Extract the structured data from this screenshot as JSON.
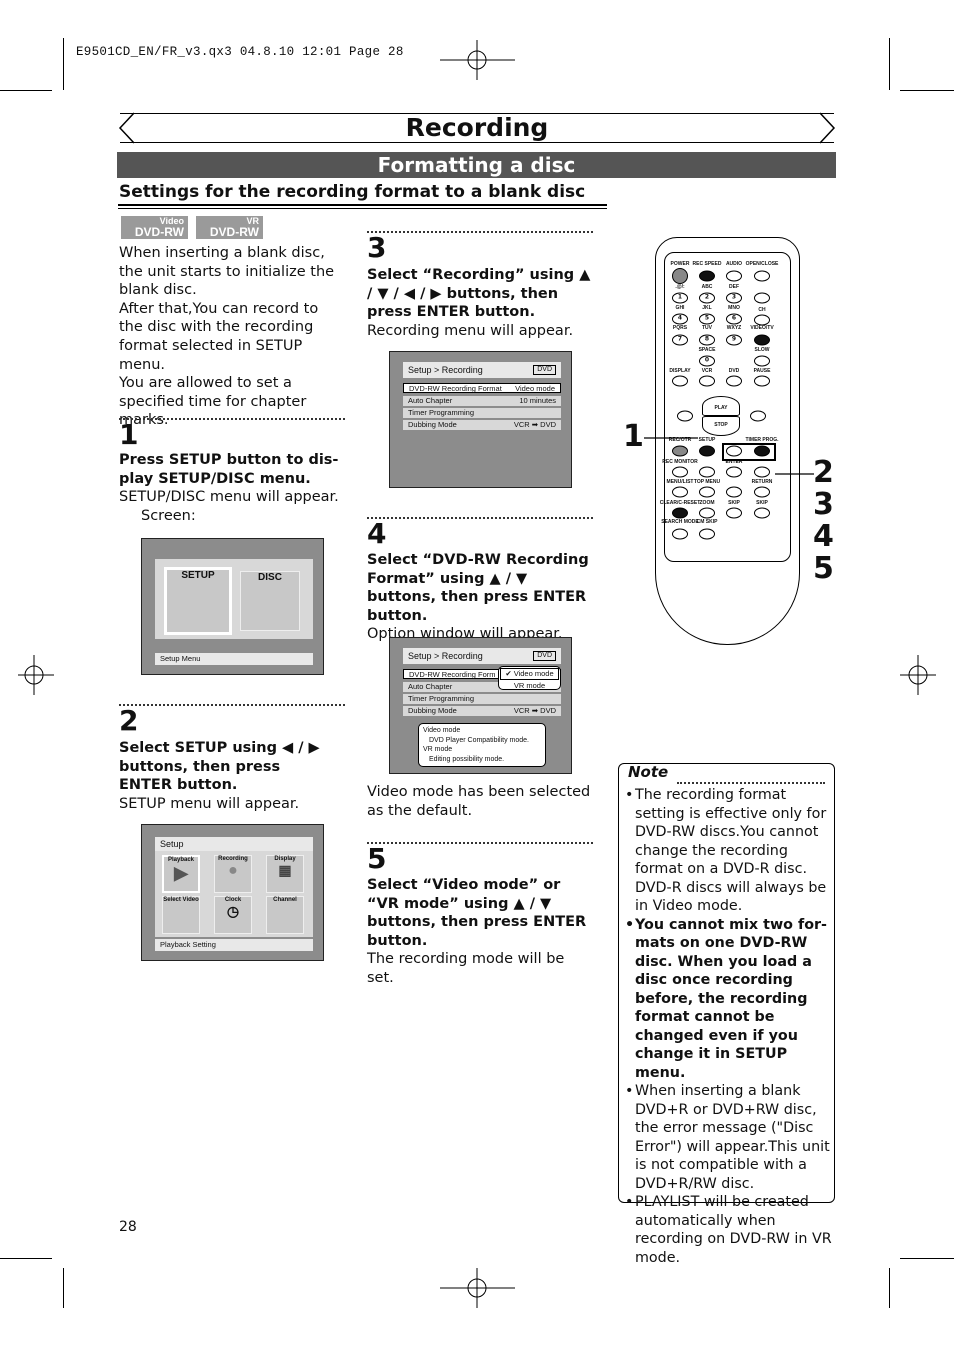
{
  "slug": "E9501CD_EN/FR_v3.qx3   04.8.10   12:01   Page 28",
  "title": "Recording",
  "subtitle": "Formatting a disc",
  "section": "Settings for the recording format to a blank disc",
  "logos": [
    {
      "top": "Video",
      "main": "DVD-RW"
    },
    {
      "top": "VR",
      "main": "DVD-RW"
    }
  ],
  "intro": [
    "When inserting a blank disc, the unit starts to initialize the blank disc.",
    "After that,You can record to the disc with the recording format selected in SETUP menu.",
    "You are allowed to set a specified time for chapter marks."
  ],
  "steps": [
    {
      "num": "1",
      "instruction": "Press SETUP button to dis-play SETUP/DISC menu.",
      "result": "SETUP/DISC menu will appear.",
      "extra": "Screen:"
    },
    {
      "num": "2",
      "instruction": "Select SETUP using ◀ / ▶ buttons, then press ENTER button.",
      "result": "SETUP menu will appear."
    },
    {
      "num": "3",
      "instruction": "Select “Recording” using ▲ / ▼ / ◀ / ▶ buttons, then press ENTER button.",
      "result": "Recording menu will appear."
    },
    {
      "num": "4",
      "instruction": "Select “DVD-RW Recording Format” using ▲ / ▼ buttons, then press ENTER button.",
      "result": "Option window will appear.",
      "after": "Video mode has been selected as the default."
    },
    {
      "num": "5",
      "instruction": "Select “Video mode” or “VR mode” using ▲ / ▼ buttons, then press ENTER button.",
      "result": "The recording mode will be set."
    }
  ],
  "screen1": {
    "tiles": [
      "SETUP",
      "DISC"
    ],
    "footer": "Setup Menu"
  },
  "screen2": {
    "header": "Setup",
    "tiles": [
      "Playback",
      "Recording",
      "Display",
      "Select Video",
      "Clock",
      "Channel"
    ],
    "footer": "Playback Setting"
  },
  "recmenu": {
    "header": "Setup > Recording",
    "tag": "DVD",
    "rows": [
      {
        "label": "DVD-RW Recording Format",
        "value": "Video mode"
      },
      {
        "label": "Auto Chapter",
        "value": "10 minutes"
      },
      {
        "label": "Timer Programming",
        "value": ""
      },
      {
        "label": "Dubbing Mode",
        "value": "VCR ➡ DVD"
      }
    ]
  },
  "optmenu": {
    "label_trunc": "DVD-RW Recording Form",
    "options": [
      "✔ Video mode",
      "VR mode"
    ],
    "help": [
      "Video mode",
      "DVD Player Compatibility mode.",
      "VR mode",
      "Editing possibility mode."
    ]
  },
  "remote": {
    "callouts": [
      "1",
      "2",
      "3",
      "4",
      "5"
    ],
    "labels": [
      "POWER",
      "REC SPEED",
      "AUDIO",
      "OPEN/CLOSE",
      ".@/:",
      "ABC",
      "DEF",
      "GHI",
      "JKL",
      "MNO",
      "CH",
      "PQRS",
      "TUV",
      "WXYZ",
      "VIDEO/TV",
      "SPACE",
      "SLOW",
      "DISPLAY",
      "VCR",
      "DVD",
      "PAUSE",
      "PLAY",
      "STOP",
      "REC/OTR",
      "SETUP",
      "TIMER PROG.",
      "REC MONITOR",
      "ENTER",
      "MENU/LIST",
      "TOP MENU",
      "RETURN",
      "CLEAR/C-RESET",
      "ZOOM",
      "SKIP",
      "SKIP",
      "SEARCH MODE",
      "CM SKIP"
    ],
    "keys": [
      "1",
      "2",
      "3",
      "4",
      "5",
      "6",
      "7",
      "8",
      "9",
      "0"
    ]
  },
  "note": {
    "title": "Note",
    "items": [
      {
        "text": "The recording format setting is effective only for DVD-RW discs.You cannot change the recording format on a DVD-R disc. DVD-R discs will always be in Video mode.",
        "bold": false
      },
      {
        "text": "You cannot mix two for-mats on one DVD-RW disc. When you load a disc once recording before, the recording format cannot be changed even if you change it in SETUP menu.",
        "bold": true
      },
      {
        "text": "When inserting a blank DVD+R or DVD+RW disc, the error message (\"Disc Error\") will appear.This unit is not compatible with a DVD+R/RW disc.",
        "bold": false
      },
      {
        "text": "PLAYLIST will be created automatically when recording on DVD-RW in VR mode.",
        "bold": false
      }
    ]
  },
  "page_number": "28"
}
